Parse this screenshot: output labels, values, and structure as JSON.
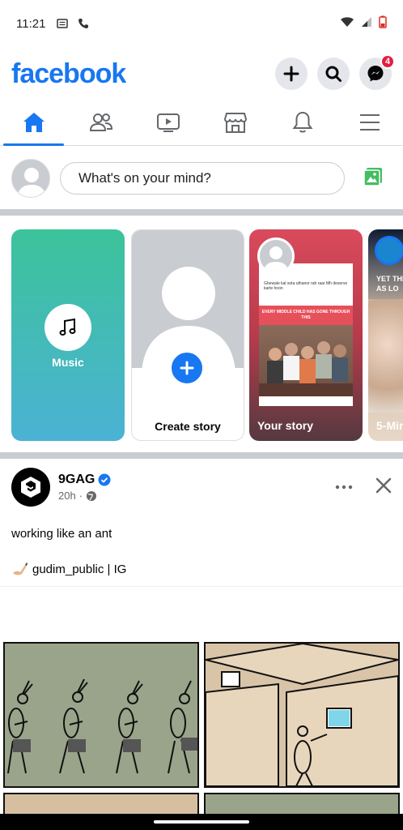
{
  "status_bar": {
    "time": "11:21"
  },
  "header": {
    "logo": "facebook",
    "messenger_badge": "4"
  },
  "tabs": [
    {
      "name": "home",
      "active": true
    },
    {
      "name": "friends"
    },
    {
      "name": "watch"
    },
    {
      "name": "marketplace"
    },
    {
      "name": "notifications"
    },
    {
      "name": "menu"
    }
  ],
  "composer": {
    "placeholder": "What's on your mind?"
  },
  "stories": {
    "music_label": "Music",
    "create_label": "Create story",
    "your_story_label": "Your story",
    "your_story_card_text": "Ghewale kal sota uthanor rah raar Mh deserve karte hoon",
    "your_story_banner": "EVERY MIDDLE CHILD HAS GONE THROUGH THIS",
    "fourth_story_headline": "YET THI AS LO",
    "fourth_story_label": "5-Minu"
  },
  "post": {
    "author": "9GAG",
    "time": "20h",
    "text": "working like an ant",
    "credit": "gudim_public | IG"
  },
  "colors": {
    "brand": "#1877F2",
    "badge": "#e41e3f"
  }
}
